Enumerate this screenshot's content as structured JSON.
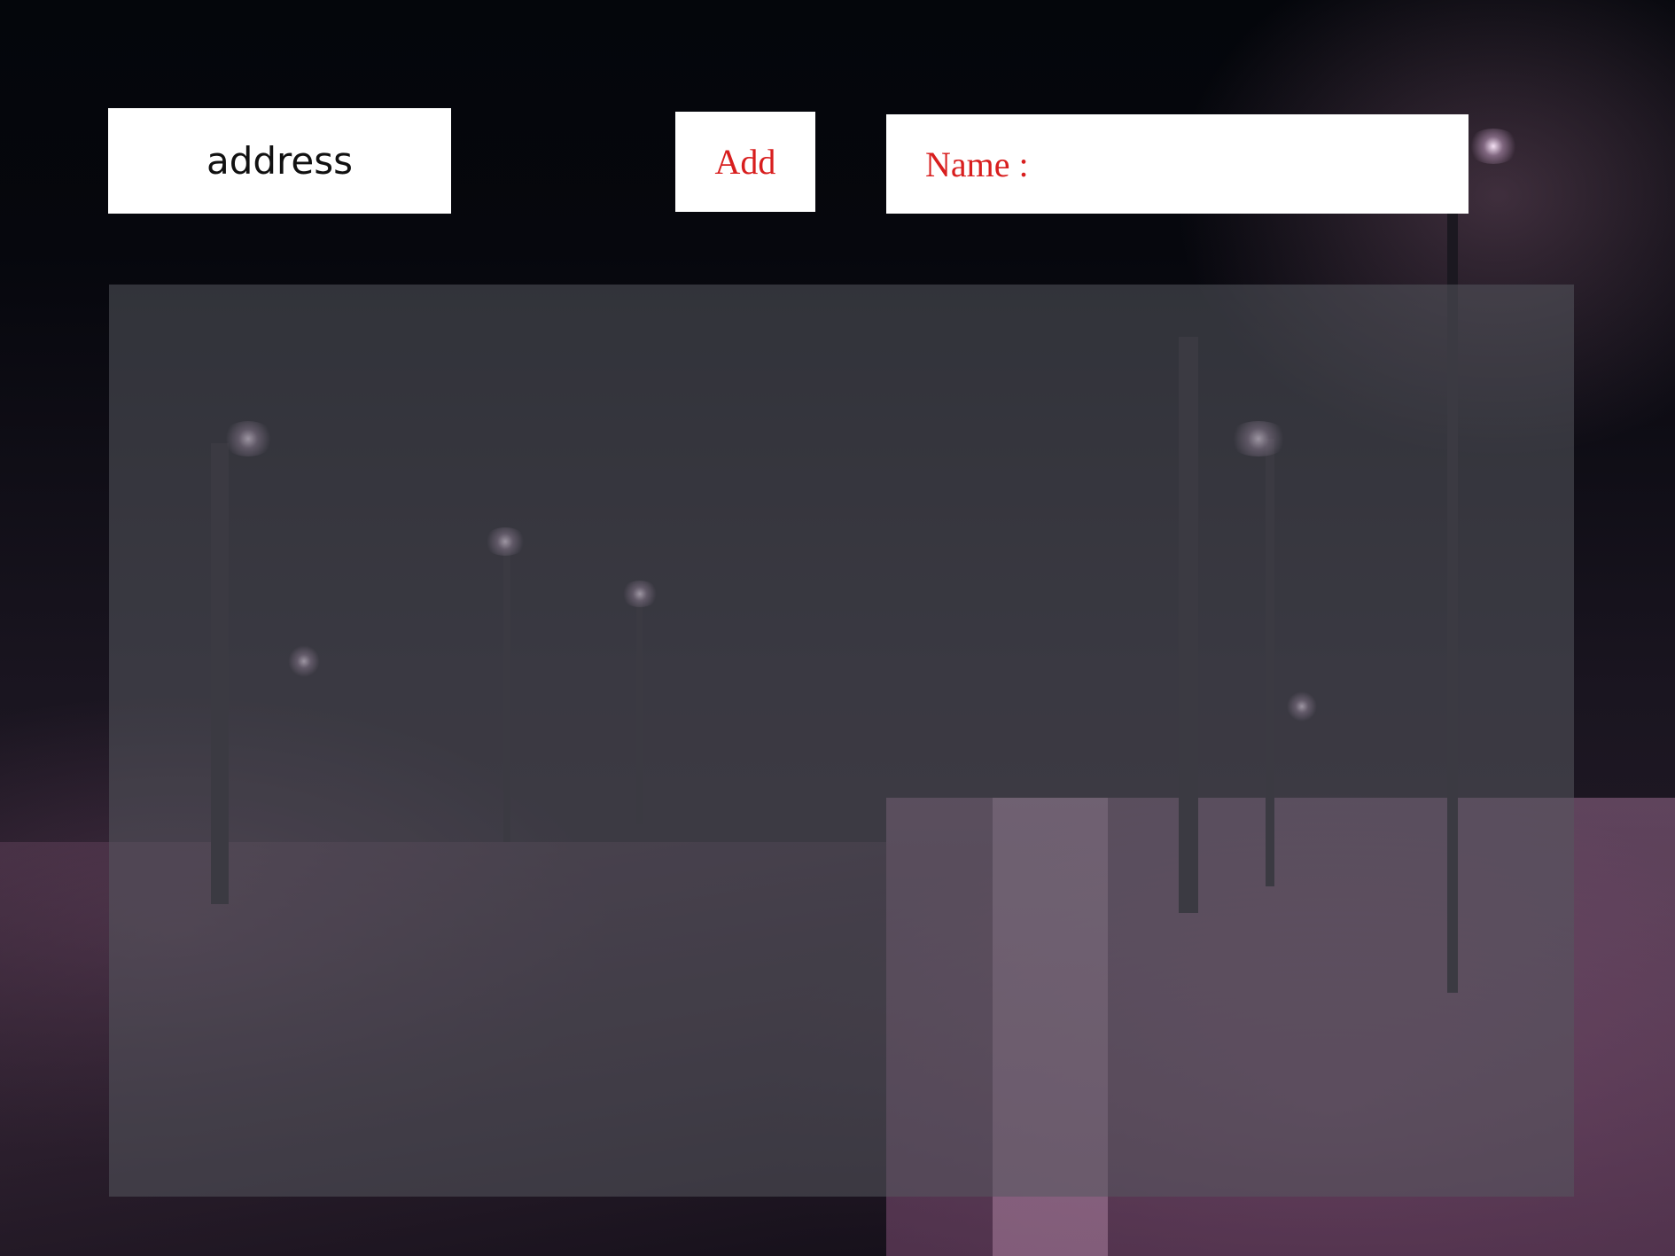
{
  "toolbar": {
    "address_label": "address",
    "add_label": "Add",
    "name_label": "Name :"
  },
  "colors": {
    "label_red": "#d81e1e",
    "box_white": "#ffffff",
    "panel_overlay": "rgba(85,88,94,0.55)"
  }
}
